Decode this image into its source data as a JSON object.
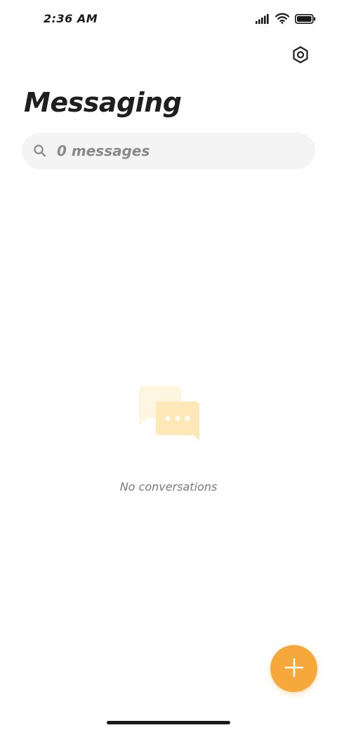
{
  "status_bar": {
    "time": "2:36 AM",
    "icons": [
      "signal-icon",
      "wifi-icon",
      "battery-icon"
    ]
  },
  "header": {
    "settings_icon": "settings-icon",
    "title": "Messaging"
  },
  "search": {
    "placeholder": "0 messages",
    "value": ""
  },
  "empty_state": {
    "icon": "chat-bubbles-icon",
    "text": "No conversations"
  },
  "fab": {
    "icon": "plus-icon"
  },
  "colors": {
    "accent": "#f6a83a",
    "search_background": "#f4f4f4",
    "illustration_back": "#fff6e2",
    "illustration_front": "#ffe8b8"
  }
}
